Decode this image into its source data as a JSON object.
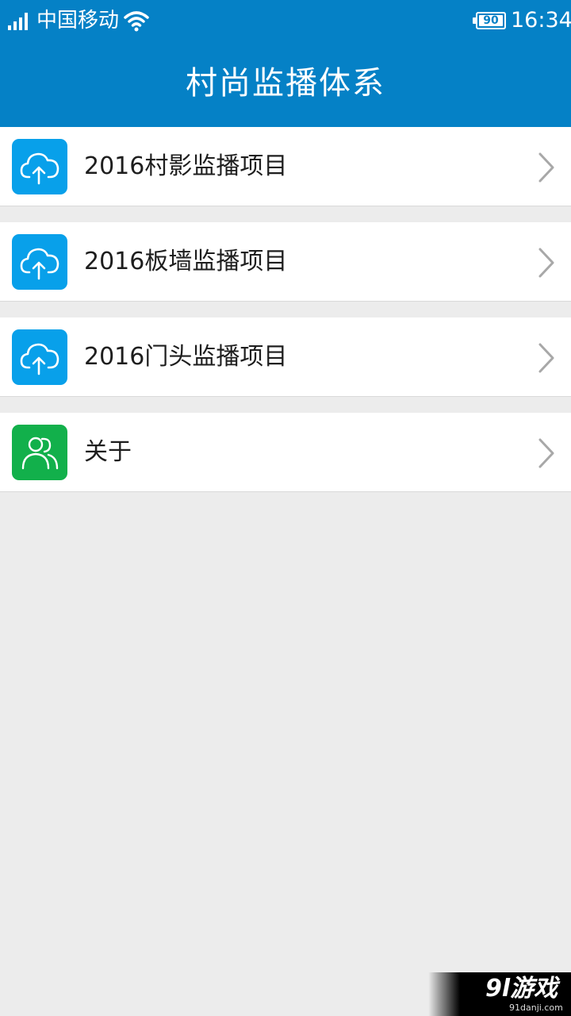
{
  "status_bar": {
    "carrier": "中国移动",
    "battery": "90",
    "time": "16:34"
  },
  "header": {
    "title": "村尚监播体系"
  },
  "menu": {
    "items": [
      {
        "label": "2016村影监播项目",
        "icon": "cloud-upload-icon",
        "icon_color": "#08a0ea"
      },
      {
        "label": "2016板墙监播项目",
        "icon": "cloud-upload-icon",
        "icon_color": "#08a0ea"
      },
      {
        "label": "2016门头监播项目",
        "icon": "cloud-upload-icon",
        "icon_color": "#08a0ea"
      },
      {
        "label": "关于",
        "icon": "people-icon",
        "icon_color": "#12b04b"
      }
    ]
  },
  "watermark": {
    "logo": "9l游戏",
    "site": "91danji.com"
  },
  "colors": {
    "header": "#0581c6",
    "background": "#ececec",
    "chevron": "#a8a8a8"
  }
}
